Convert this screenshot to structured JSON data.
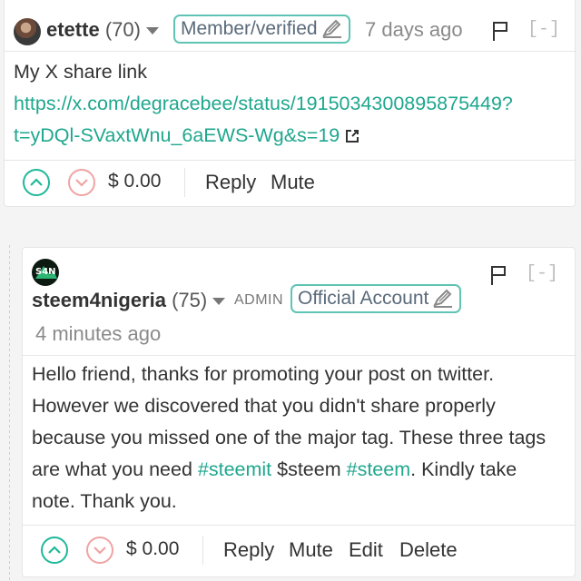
{
  "comment1": {
    "author": "etette",
    "reputation": "(70)",
    "badge": "Member/verified",
    "time": "7 days ago",
    "collapse": "[-]",
    "body_text": "My X share link",
    "link_line1": "https://x.com/degracebee/status/1915034300895875449?",
    "link_line2": "t=yDQl-SVaxtWnu_6aEWS-Wg&s=19",
    "payout": "$ 0.00",
    "actions": {
      "reply": "Reply",
      "mute": "Mute"
    }
  },
  "comment2": {
    "author": "steem4nigeria",
    "reputation": "(75)",
    "role": "ADMIN",
    "badge": "Official Account",
    "time": "4 minutes ago",
    "collapse": "[-]",
    "body": {
      "line1": "Hello friend, thanks for promoting your post on twitter.",
      "line2": "However we discovered that you didn't share properly",
      "line3": "because you missed one of the major tag. These three tags",
      "line4_pre": "are what you need ",
      "tag1": "#steemit",
      "mid1": " $steem ",
      "tag2": "#steem",
      "line4_post": ". Kindly take",
      "line5": "note. Thank you."
    },
    "payout": "$ 0.00",
    "actions": {
      "reply": "Reply",
      "mute": "Mute",
      "edit": "Edit",
      "delete": "Delete"
    }
  },
  "colors": {
    "accent": "#1fa78e",
    "badge_border": "#5fc4b4",
    "downvote": "#f0a3a3"
  }
}
